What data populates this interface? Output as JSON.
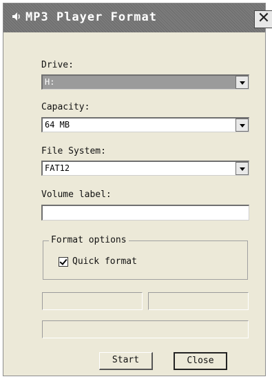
{
  "window": {
    "title": "MP3 Player Format",
    "close_glyph": "✕"
  },
  "fields": {
    "drive_label": "Drive:",
    "drive_value": "H:",
    "capacity_label": "Capacity:",
    "capacity_value": "64 MB",
    "filesystem_label": "File System:",
    "filesystem_value": "FAT12",
    "volume_label": "Volume label:",
    "volume_value": ""
  },
  "options": {
    "group_title": "Format options",
    "quick_format_label": "Quick format",
    "quick_format_checked": true
  },
  "buttons": {
    "start_label": "Start",
    "close_label": "Close"
  },
  "icons": {
    "title_icon": "speaker-icon",
    "close_icon": "close-icon",
    "dropdown_icon": "chevron-down-icon"
  },
  "colors": {
    "dialog_bg": "#ece9d8",
    "titlebar": "#767676",
    "selection": "#9b9b9b"
  }
}
